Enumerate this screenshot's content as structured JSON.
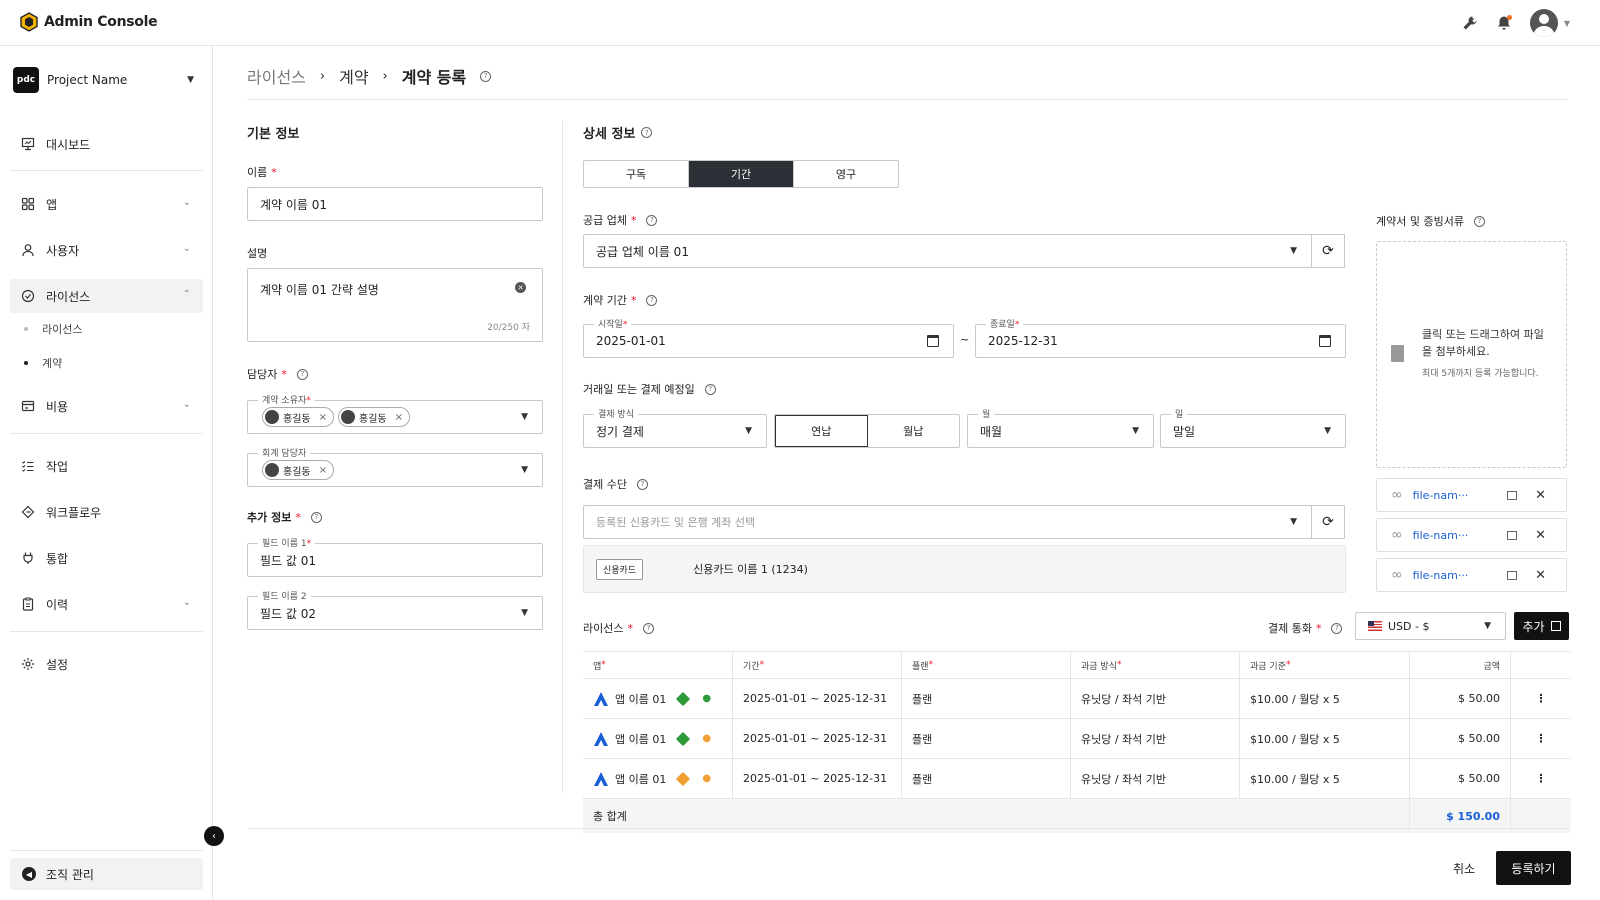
{
  "app": {
    "title": "Admin Console"
  },
  "project": {
    "name": "Project Name",
    "logo": "pdc"
  },
  "nav": {
    "items": [
      {
        "label": "대시보드",
        "icon": "dashboard-icon"
      },
      {
        "label": "앱",
        "icon": "apps-icon"
      },
      {
        "label": "사용자",
        "icon": "user-icon"
      },
      {
        "label": "라이선스",
        "icon": "license-icon"
      },
      {
        "label": "비용",
        "icon": "cost-icon"
      },
      {
        "label": "작업",
        "icon": "task-icon"
      },
      {
        "label": "워크플로우",
        "icon": "workflow-icon"
      },
      {
        "label": "통합",
        "icon": "plug-icon"
      },
      {
        "label": "이력",
        "icon": "history-icon"
      },
      {
        "label": "설정",
        "icon": "gear-icon"
      }
    ],
    "sub": [
      "라이선스",
      "계약"
    ],
    "org": "조직 관리"
  },
  "breadcrumb": [
    "라이선스",
    "계약",
    "계약 등록"
  ],
  "basic": {
    "title": "기본 정보",
    "name_label": "이름",
    "name_value": "계약 이름 01",
    "desc_label": "설명",
    "desc_value": "계약 이름 01 간략 설명",
    "desc_count": "20/250 자",
    "manager_label": "담당자",
    "owner_label": "계약 소유자",
    "owner_chips": [
      "홍길동",
      "홍길동"
    ],
    "acct_label": "회계 담당자",
    "acct_chips": [
      "홍길동"
    ],
    "extra_label": "추가 정보",
    "field1_label": "필드 이름 1",
    "field1_value": "필드 값 01",
    "field2_label": "필드 이름 2",
    "field2_value": "필드 값 02"
  },
  "detail": {
    "title": "상세 정보",
    "tabs": [
      "구독",
      "기간",
      "영구"
    ],
    "supplier_label": "공급 업체",
    "supplier_value": "공급 업체 이름 01",
    "period_label": "계약 기간",
    "start_label": "시작일",
    "start_value": "2025-01-01",
    "end_label": "종료일",
    "end_value": "2025-12-31",
    "tilde": "~",
    "pay_date_label": "거래일 또는 결제 예정일",
    "pay_method_label": "결제 방식",
    "pay_method_value": "정기 결제",
    "toggle": [
      "연납",
      "월납"
    ],
    "month_label": "월",
    "month_value": "매월",
    "day_label": "일",
    "day_value": "말일",
    "means_label": "결제 수단",
    "means_placeholder": "등록된 신용카드 및 은행 계좌 선택",
    "card_tag": "신용카드",
    "card_name": "신용카드 이름 1 (1234)"
  },
  "license": {
    "title": "라이선스",
    "currency_label": "결제 통화",
    "currency_value": "USD - $",
    "add_label": "추가",
    "headers": [
      "앱",
      "기간",
      "플랜",
      "과금 방식",
      "과금 기준",
      "금액"
    ],
    "rows": [
      {
        "app": "앱 이름 01",
        "period": "2025-01-01 ~ 2025-12-31",
        "plan": "플랜",
        "billing": "유닛당 / 좌석 기반",
        "basis": "$10.00 / 월당 x 5",
        "amount": "$ 50.00"
      },
      {
        "app": "앱 이름 01",
        "period": "2025-01-01 ~ 2025-12-31",
        "plan": "플랜",
        "billing": "유닛당 / 좌석 기반",
        "basis": "$10.00 / 월당 x 5",
        "amount": "$ 50.00"
      },
      {
        "app": "앱 이름 01",
        "period": "2025-01-01 ~ 2025-12-31",
        "plan": "플랜",
        "billing": "유닛당 / 좌석 기반",
        "basis": "$10.00 / 월당 x 5",
        "amount": "$ 50.00"
      }
    ],
    "total_label": "총 합계",
    "total_value": "$ 150.00"
  },
  "attach": {
    "title": "계약서 및 증빙서류",
    "drop_text": "클릭 또는 드래그하여 파일을 첨부하세요.",
    "drop_sub": "최대 5개까지 등록 가능합니다.",
    "files": [
      "file-nam···",
      "file-nam···",
      "file-nam···"
    ]
  },
  "footer": {
    "cancel": "취소",
    "submit": "등록하기"
  },
  "colors": {
    "accent": "#1a5fd6",
    "dark": "#2b2f36",
    "required": "#e12",
    "green": "#2e9b3a",
    "orange": "#f0a030"
  }
}
